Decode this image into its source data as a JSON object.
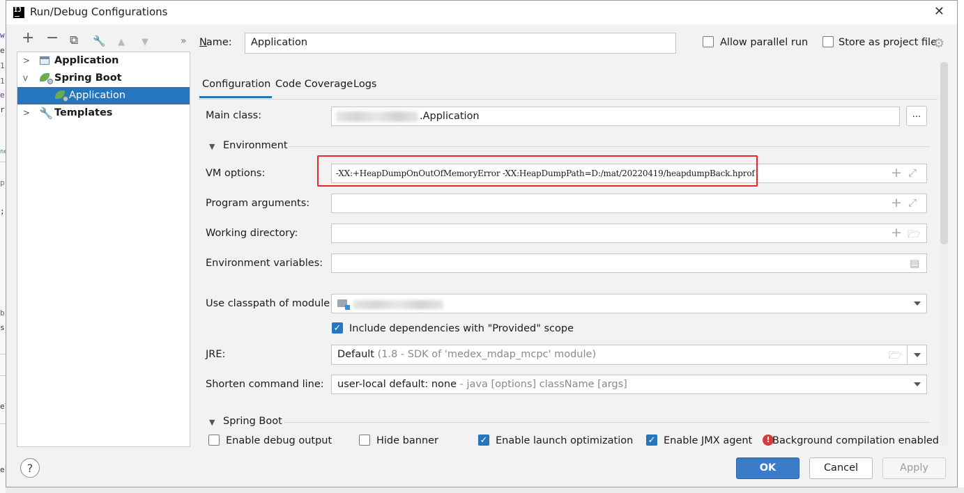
{
  "window": {
    "title": "Run/Debug Configurations"
  },
  "background_editor": {
    "chars": [
      "w",
      "e",
      "1",
      "1",
      "e",
      "r",
      "ne",
      "p",
      ";",
      "b",
      "s",
      "el",
      "el"
    ]
  },
  "toolbar": {
    "add": "+",
    "remove": "−",
    "copy": "⧉",
    "edit": "🔧",
    "up": "▲",
    "down": "▼",
    "more": "»"
  },
  "tree": {
    "items": [
      {
        "label": "Application",
        "level": 0,
        "expanded": false,
        "selected": false
      },
      {
        "label": "Spring Boot",
        "level": 0,
        "expanded": true,
        "selected": false
      },
      {
        "label": "Application",
        "level": 1,
        "expanded": false,
        "selected": true
      },
      {
        "label": "Templates",
        "level": 0,
        "expanded": false,
        "selected": false
      }
    ]
  },
  "header": {
    "name_label": "Name:",
    "name_value": "Application",
    "allow_parallel_label": "Allow parallel run",
    "allow_parallel_checked": false,
    "store_project_label": "Store as project file",
    "store_project_checked": false
  },
  "tabs": [
    {
      "label": "Configuration",
      "active": true
    },
    {
      "label": "Code Coverage",
      "active": false
    },
    {
      "label": "Logs",
      "active": false
    }
  ],
  "config": {
    "main_class_label": "Main class:",
    "main_class_value": ".Application",
    "main_class_browse": "...",
    "environment_section": "Environment",
    "vm_options_label": "VM options:",
    "vm_options_value": "-XX:+HeapDumpOnOutOfMemoryError -XX:HeapDumpPath=D:/mat/20220419/heapdumpBack.hprof",
    "program_args_label": "Program arguments:",
    "program_args_value": "",
    "working_dir_label": "Working directory:",
    "working_dir_value": "",
    "env_vars_label": "Environment variables:",
    "env_vars_value": "",
    "classpath_label": "Use classpath of module:",
    "include_deps_label": "Include dependencies with \"Provided\" scope",
    "include_deps_checked": true,
    "jre_label": "JRE:",
    "jre_value": "Default",
    "jre_hint": "(1.8 - SDK of 'medex_mdap_mcpc' module)",
    "shorten_label": "Shorten command line:",
    "shorten_value": "user-local default: none",
    "shorten_hint": "- java [options] className [args]",
    "spring_boot_section": "Spring Boot",
    "enable_debug_label": "Enable debug output",
    "enable_debug_checked": false,
    "hide_banner_label": "Hide banner",
    "hide_banner_checked": false,
    "enable_launch_label": "Enable launch optimization",
    "enable_launch_checked": true,
    "enable_jmx_label": "Enable JMX agent",
    "enable_jmx_checked": true,
    "bg_compile_label": "Background compilation enabled"
  },
  "footer": {
    "help": "?",
    "ok": "OK",
    "cancel": "Cancel",
    "apply": "Apply"
  },
  "colors": {
    "accent": "#2675bf",
    "highlight_box": "#e5282b",
    "error": "#d43b3b"
  }
}
